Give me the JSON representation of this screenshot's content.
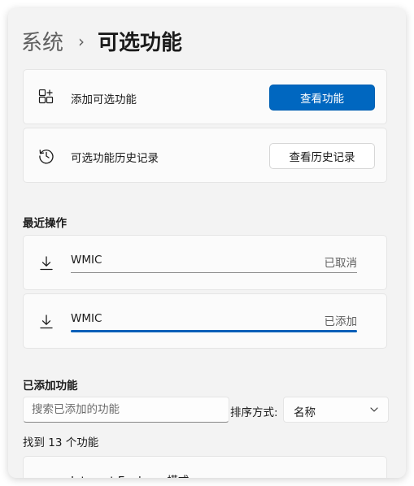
{
  "breadcrumb": {
    "parent": "系统",
    "separator": "›",
    "current": "可选功能"
  },
  "add_feature": {
    "label": "添加可选功能",
    "button": "查看功能",
    "icon": "add-feature-icon"
  },
  "history": {
    "label": "可选功能历史记录",
    "button": "查看历史记录",
    "icon": "history-icon"
  },
  "recent": {
    "title": "最近操作",
    "items": [
      {
        "name": "WMIC",
        "status": "已取消",
        "progress": 1.0,
        "progress_color": "#8a8a8a",
        "icon": "download-icon"
      },
      {
        "name": "WMIC",
        "status": "已添加",
        "progress": 1.0,
        "progress_color": "#005fb8",
        "icon": "download-icon"
      }
    ]
  },
  "installed": {
    "title": "已添加功能",
    "search_placeholder": "搜索已添加的功能",
    "sort_label": "排序方式:",
    "sort_value": "名称",
    "found_text": "找到 13 个功能",
    "first_item": "Internet Explorer 模式"
  },
  "colors": {
    "accent": "#0067c0",
    "background": "#f3f3f3",
    "card": "#fbfbfb"
  }
}
